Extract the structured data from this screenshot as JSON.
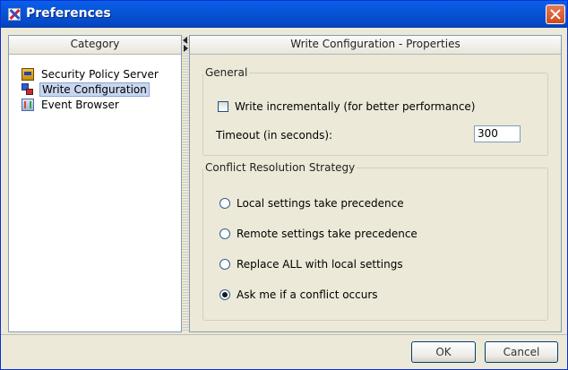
{
  "window": {
    "title": "Preferences"
  },
  "left_panel": {
    "header": "Category",
    "items": [
      {
        "label": "Security Policy Server",
        "icon": "server-icon",
        "selected": false
      },
      {
        "label": "Write Configuration",
        "icon": "write-config-icon",
        "selected": true
      },
      {
        "label": "Event Browser",
        "icon": "event-browser-icon",
        "selected": false
      }
    ]
  },
  "right_panel": {
    "header": "Write Configuration - Properties",
    "general": {
      "legend": "General",
      "write_incrementally_label": "Write incrementally (for better performance)",
      "write_incrementally_checked": false,
      "timeout_label": "Timeout (in seconds):",
      "timeout_value": "300"
    },
    "conflict": {
      "legend": "Conflict Resolution Strategy",
      "options": [
        {
          "label": "Local settings take precedence",
          "checked": false
        },
        {
          "label": "Remote settings take precedence",
          "checked": false
        },
        {
          "label": "Replace ALL with local settings",
          "checked": false
        },
        {
          "label": "Ask me if a conflict occurs",
          "checked": true
        }
      ]
    }
  },
  "buttons": {
    "ok": "OK",
    "cancel": "Cancel"
  },
  "colors": {
    "title_bar": "#0854d8",
    "selection": "#c8d6ef",
    "close_button": "#d04a1f"
  }
}
